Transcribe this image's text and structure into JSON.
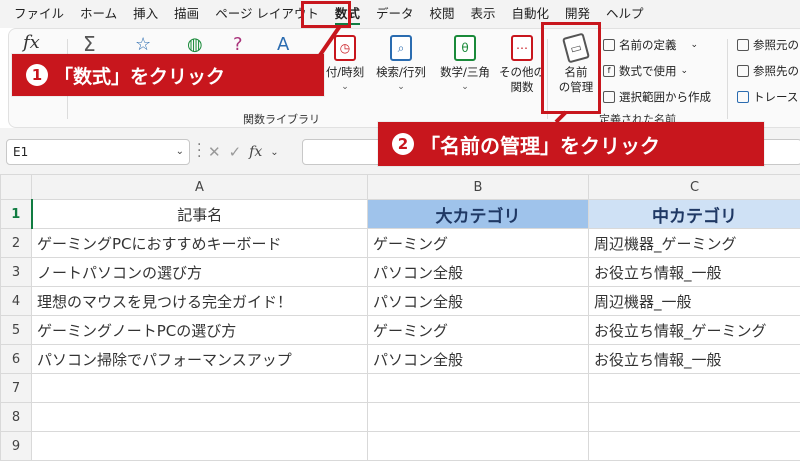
{
  "menu": {
    "items": [
      "ファイル",
      "ホーム",
      "挿入",
      "描画",
      "ページ レイアウト",
      "数式",
      "データ",
      "校閲",
      "表示",
      "自動化",
      "開発",
      "ヘルプ"
    ],
    "active": "数式"
  },
  "ribbon": {
    "fx_icon": "fx",
    "buttons": {
      "datetime": "付/時刻",
      "lookup": "検索/行列",
      "math": "数学/三角",
      "more": "その他の",
      "more_line2": "関数",
      "name_manager_l1": "名前",
      "name_manager_l2": "の管理"
    },
    "group_function_library": "関数ライブラリ",
    "group_defined_names": "定義された名前",
    "defined_names": {
      "define_name": "名前の定義",
      "use_in_formula": "数式で使用",
      "create_from_selection": "選択範囲から作成"
    },
    "formula_auditing": {
      "trace_precedents": "参照元の",
      "trace_dependents": "参照先の",
      "trace": "トレース"
    }
  },
  "callouts": {
    "step1_num": "1",
    "step1_text": "「数式」をクリック",
    "step2_num": "2",
    "step2_text": "「名前の管理」をクリック"
  },
  "formula_bar": {
    "name_box": "E1",
    "fx": "fx",
    "formula": ""
  },
  "sheet": {
    "columns": [
      "A",
      "B",
      "C"
    ],
    "headers": [
      "記事名",
      "大カテゴリ",
      "中カテゴリ"
    ],
    "rows": [
      [
        "ゲーミングPCにおすすめキーボード",
        "ゲーミング",
        "周辺機器_ゲーミング"
      ],
      [
        "ノートパソコンの選び方",
        "パソコン全般",
        "お役立ち情報_一般"
      ],
      [
        "理想のマウスを見つける完全ガイド！",
        "パソコン全般",
        "周辺機器_一般"
      ],
      [
        "ゲーミングノートPCの選び方",
        "ゲーミング",
        "お役立ち情報_ゲーミング"
      ],
      [
        "パソコン掃除でパフォーマンスアップ",
        "パソコン全般",
        "お役立ち情報_一般"
      ],
      [
        "",
        "",
        ""
      ],
      [
        "",
        "",
        ""
      ],
      [
        "",
        "",
        ""
      ]
    ],
    "row_numbers": [
      "1",
      "2",
      "3",
      "4",
      "5",
      "6",
      "7",
      "8",
      "9"
    ]
  },
  "colors": {
    "accent": "#c8161d",
    "excel_green": "#107c41",
    "header_blue": "#9fc3eb",
    "header_light_blue": "#cfe1f5"
  }
}
